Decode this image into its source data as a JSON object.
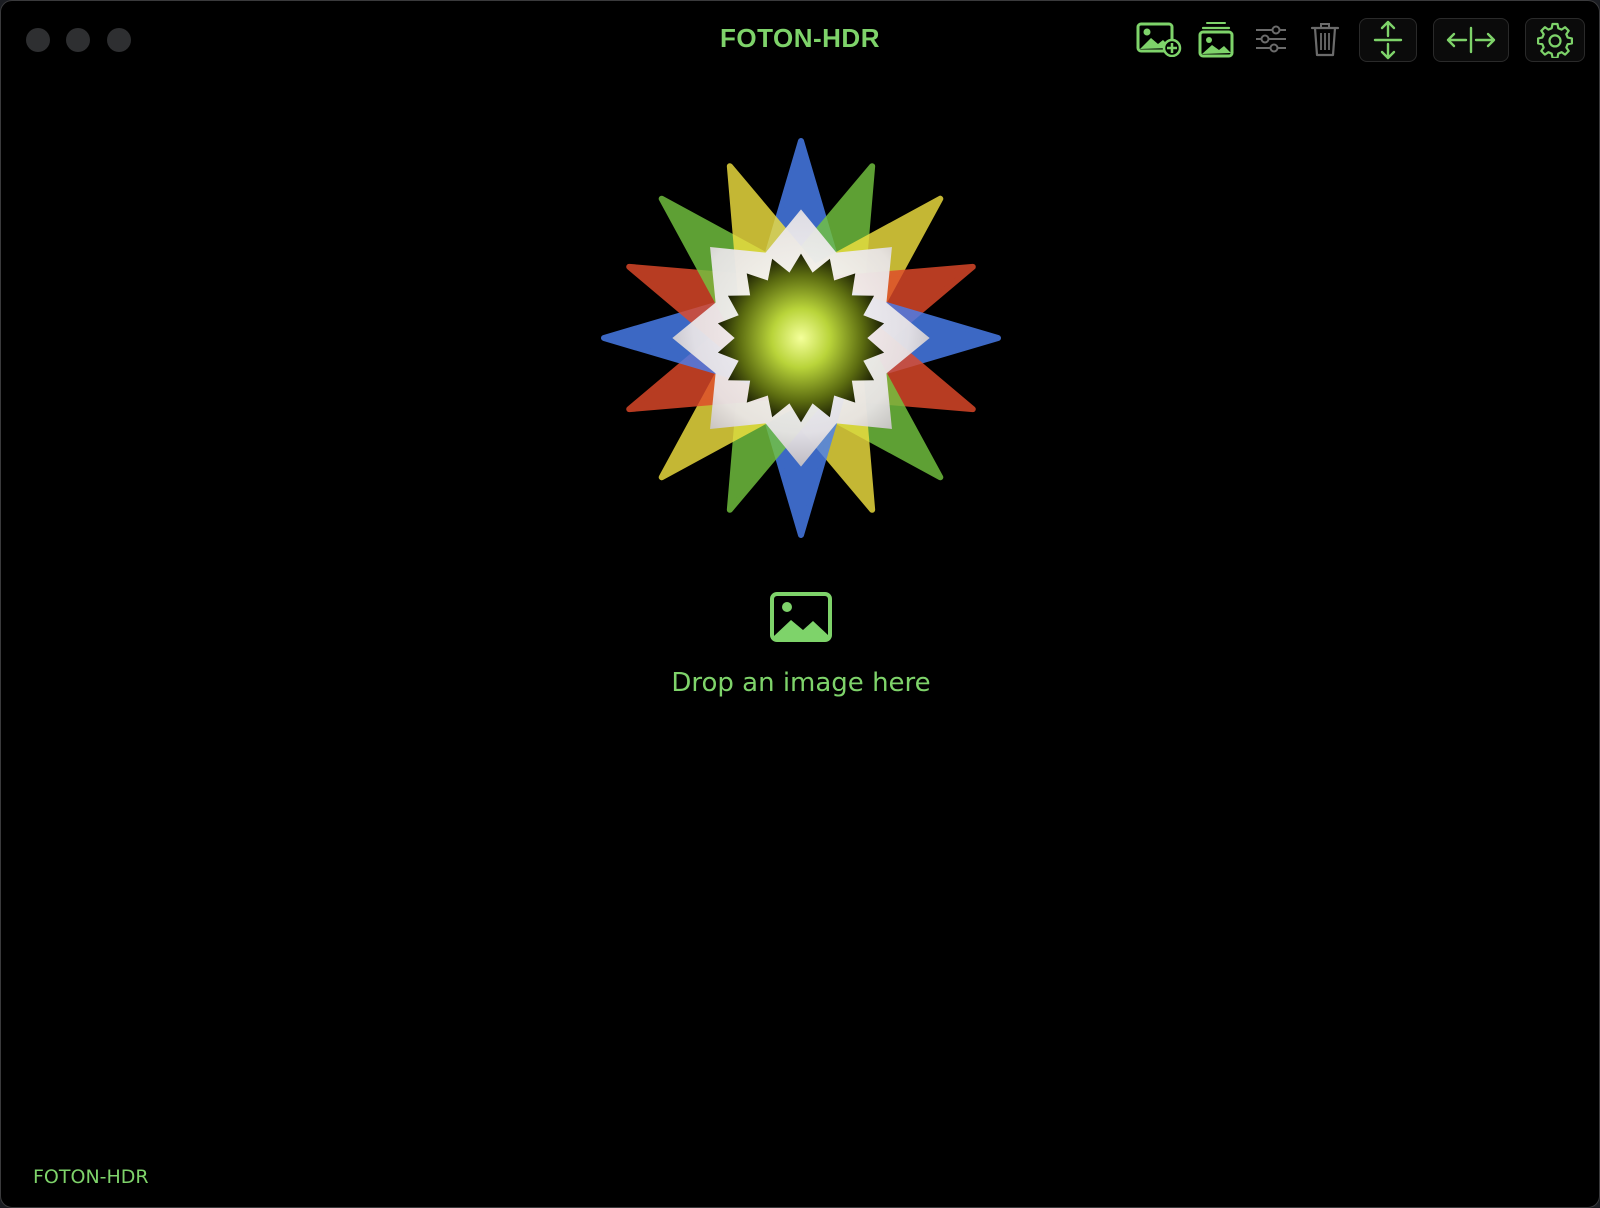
{
  "app": {
    "title": "FOTON-HDR",
    "accent_color": "#7ed36a",
    "disabled_color": "#6b6b6b"
  },
  "window_controls": [
    "close-button",
    "minimize-button",
    "zoom-button"
  ],
  "toolbar": {
    "items": [
      {
        "name": "add-image-button",
        "icon": "image-plus-icon",
        "enabled": true
      },
      {
        "name": "image-stack-button",
        "icon": "image-stack-icon",
        "enabled": true
      },
      {
        "name": "adjustments-button",
        "icon": "sliders-icon",
        "enabled": false
      },
      {
        "name": "delete-button",
        "icon": "trash-icon",
        "enabled": false
      },
      {
        "name": "vertical-split-button",
        "icon": "arrows-vertical-icon",
        "enabled": true
      },
      {
        "name": "horizontal-split-button",
        "icon": "arrows-horizontal-icon",
        "enabled": true
      },
      {
        "name": "settings-button",
        "icon": "gear-icon",
        "enabled": true
      }
    ]
  },
  "main": {
    "logo": "foton-hdr-star-logo",
    "drop_icon": "image-icon",
    "drop_text": "Drop an image here"
  },
  "footer": {
    "label": "FOTON-HDR"
  }
}
